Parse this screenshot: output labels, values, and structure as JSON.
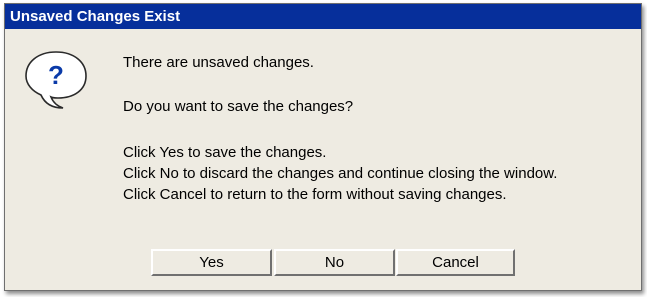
{
  "dialog": {
    "title": "Unsaved Changes Exist",
    "icon": "question-bubble-icon",
    "icon_glyph": "?",
    "message_line1": "There are unsaved changes.",
    "message_line2": "Do you want to save the changes?",
    "instructions": [
      "Click Yes to save the changes.",
      "Click No to discard the changes and continue closing the window.",
      "Click Cancel to return to the form without saving changes."
    ],
    "buttons": {
      "yes": "Yes",
      "no": "No",
      "cancel": "Cancel"
    }
  },
  "colors": {
    "titlebar": "#062f9b",
    "background": "#eeebe2",
    "icon_glyph": "#0a3aa8"
  }
}
